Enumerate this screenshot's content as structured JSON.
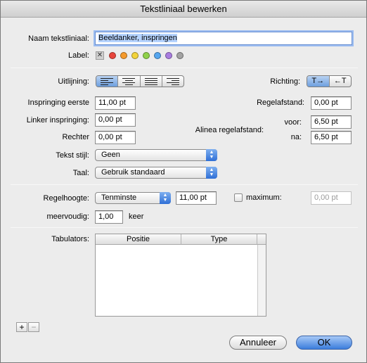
{
  "window": {
    "title": "Tekstliniaal bewerken"
  },
  "name_section": {
    "name_label": "Naam tekstliniaal:",
    "name_value": "Beeldanker, inspringen",
    "label_label": "Label:",
    "label_colors": [
      "#e8453c",
      "#f59a2c",
      "#f2d33a",
      "#8fd14a",
      "#55a6ef",
      "#a97de0",
      "#a3a3a3"
    ]
  },
  "paragraph_section": {
    "alignment_label": "Uitlijning:",
    "alignment_options": [
      "left",
      "center",
      "justify",
      "right"
    ],
    "alignment_selected": "left",
    "direction_label": "Richting:",
    "direction_options": [
      "T→",
      "←T"
    ],
    "direction_selected": "T→",
    "first_indent_label": "Inspringing eerste",
    "first_indent_value": "11,00 pt",
    "left_indent_label": "Linker inspringing:",
    "left_indent_value": "0,00 pt",
    "right_indent_label": "Rechter",
    "right_indent_value": "0,00 pt",
    "line_spacing_label": "Regelafstand:",
    "line_spacing_value": "0,00 pt",
    "paragraph_spacing_label": "Alinea regelafstand:",
    "before_label": "voor:",
    "before_value": "6,50 pt",
    "after_label": "na:",
    "after_value": "6,50 pt",
    "text_style_label": "Tekst stijl:",
    "text_style_value": "Geen",
    "language_label": "Taal:",
    "language_value": "Gebruik standaard"
  },
  "line_height_section": {
    "line_height_label": "Regelhoogte:",
    "line_height_mode": "Tenminste",
    "line_height_value": "11,00 pt",
    "maximum_label": "maximum:",
    "maximum_value": "0,00 pt",
    "multiple_label": "meervoudig:",
    "multiple_value": "1,00",
    "multiple_unit": "keer"
  },
  "tabs_section": {
    "tabs_label": "Tabulators:",
    "columns": [
      "Positie",
      "Type"
    ],
    "add_symbol": "+",
    "remove_symbol": "−"
  },
  "footer": {
    "cancel_label": "Annuleer",
    "ok_label": "OK"
  }
}
